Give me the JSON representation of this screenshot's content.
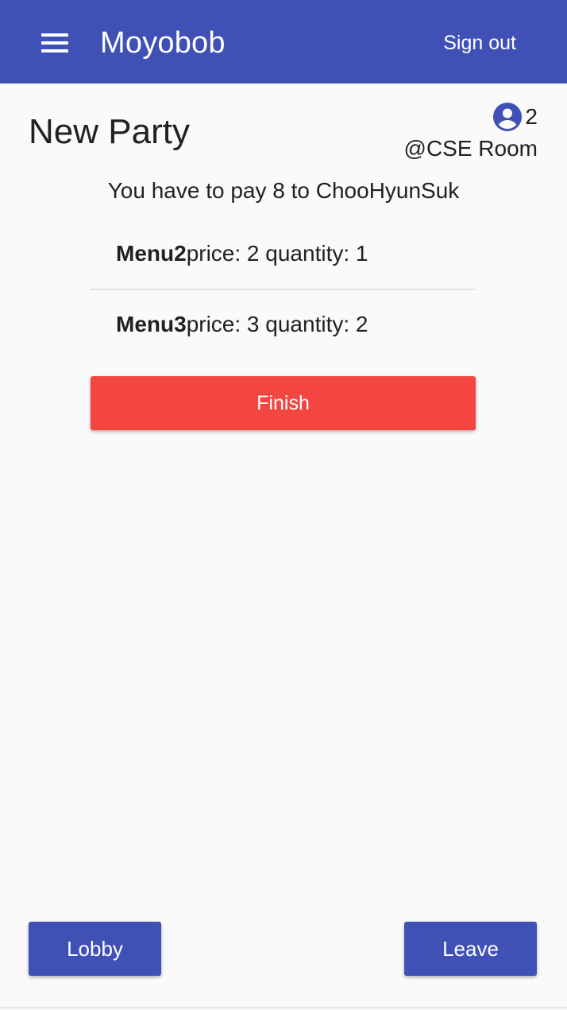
{
  "appbar": {
    "menu_icon": "hamburger-menu-icon",
    "title": "Moyobob",
    "signout_label": "Sign out",
    "color": "#3f51b5"
  },
  "party": {
    "title": "New Party",
    "member_icon": "account-circle-icon",
    "member_count": "2",
    "location": "@CSE Room",
    "pay_message": "You have to pay 8 to ChooHyunSuk"
  },
  "items": [
    {
      "name": "Menu2",
      "details": " price: 2 quantity: 1"
    },
    {
      "name": "Menu3",
      "details": " price: 3 quantity: 2"
    }
  ],
  "actions": {
    "finish_label": "Finish",
    "finish_color": "#f44640",
    "lobby_label": "Lobby",
    "leave_label": "Leave"
  }
}
